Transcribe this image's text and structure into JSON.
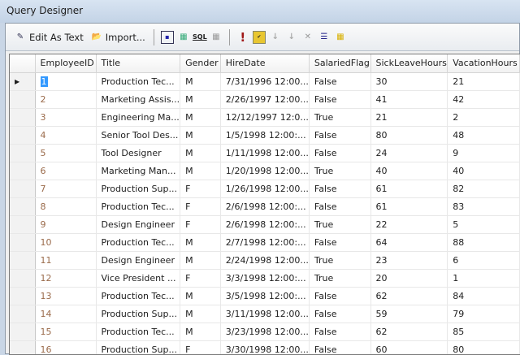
{
  "window": {
    "title": "Query Designer"
  },
  "toolbar": {
    "edit_as_text": "Edit As Text",
    "import": "Import...",
    "sql": "SQL"
  },
  "grid": {
    "columns": [
      "EmployeeID",
      "Title",
      "Gender",
      "HireDate",
      "SalariedFlag",
      "SickLeaveHours",
      "VacationHours"
    ],
    "rows": [
      [
        "1",
        "Production Tec...",
        "M",
        "7/31/1996 12:00...",
        "False",
        "30",
        "21"
      ],
      [
        "2",
        "Marketing Assis...",
        "M",
        "2/26/1997 12:00...",
        "False",
        "41",
        "42"
      ],
      [
        "3",
        "Engineering Ma...",
        "M",
        "12/12/1997 12:0...",
        "True",
        "21",
        "2"
      ],
      [
        "4",
        "Senior Tool Des...",
        "M",
        "1/5/1998 12:00:...",
        "False",
        "80",
        "48"
      ],
      [
        "5",
        "Tool Designer",
        "M",
        "1/11/1998 12:00...",
        "False",
        "24",
        "9"
      ],
      [
        "6",
        "Marketing Man...",
        "M",
        "1/20/1998 12:00...",
        "True",
        "40",
        "40"
      ],
      [
        "7",
        "Production Sup...",
        "F",
        "1/26/1998 12:00...",
        "False",
        "61",
        "82"
      ],
      [
        "8",
        "Production Tec...",
        "F",
        "2/6/1998 12:00:...",
        "False",
        "61",
        "83"
      ],
      [
        "9",
        "Design Engineer",
        "F",
        "2/6/1998 12:00:...",
        "True",
        "22",
        "5"
      ],
      [
        "10",
        "Production Tec...",
        "M",
        "2/7/1998 12:00:...",
        "False",
        "64",
        "88"
      ],
      [
        "11",
        "Design Engineer",
        "M",
        "2/24/1998 12:00...",
        "True",
        "23",
        "6"
      ],
      [
        "12",
        "Vice President ...",
        "F",
        "3/3/1998 12:00:...",
        "True",
        "20",
        "1"
      ],
      [
        "13",
        "Production Tec...",
        "M",
        "3/5/1998 12:00:...",
        "False",
        "62",
        "84"
      ],
      [
        "14",
        "Production Sup...",
        "M",
        "3/11/1998 12:00...",
        "False",
        "59",
        "79"
      ],
      [
        "15",
        "Production Tec...",
        "M",
        "3/23/1998 12:00...",
        "False",
        "62",
        "85"
      ],
      [
        "16",
        "Production Sup...",
        "F",
        "3/30/1998 12:00...",
        "False",
        "60",
        "80"
      ]
    ]
  }
}
